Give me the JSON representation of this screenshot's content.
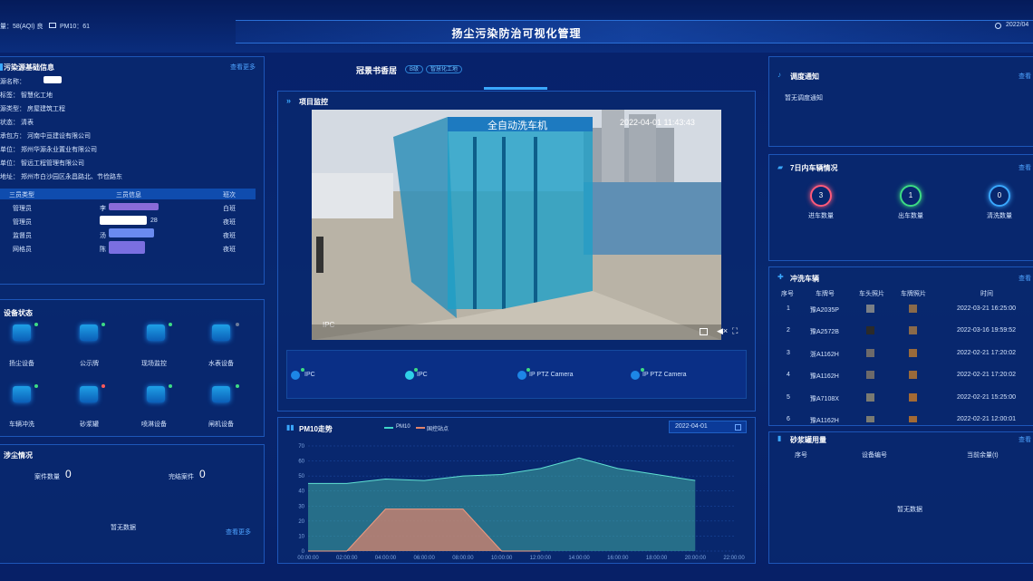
{
  "header": {
    "aqi_text": "量：58(AQI) 良",
    "pm10_text": "PM10：61",
    "title": "扬尘污染防治可视化管理",
    "date_text": "2022/04"
  },
  "left": {
    "info": {
      "title": "污染源基础信息",
      "more": "查看更多",
      "rows": [
        "源名称：",
        "标签： 智慧化工地",
        "源类型： 房屋建筑工程",
        "状态： 清表",
        "承包方： 河南中亘建设有限公司",
        "单位： 郑州华源永业置业有限公司",
        "单位： 智远工程管理有限公司",
        "地址： 郑州市白沙园区永昌路北、节俭路东"
      ],
      "staff_headers": [
        "三员类型",
        "三员信息",
        "班次"
      ],
      "staff": [
        {
          "type": "管理员",
          "info": "李",
          "shift": "白班"
        },
        {
          "type": "管理员",
          "info": "28",
          "shift": "夜班"
        },
        {
          "type": "监督员",
          "info": "汤",
          "shift": "夜班"
        },
        {
          "type": "网格员",
          "info": "陈",
          "shift": "夜班"
        }
      ]
    },
    "devices": {
      "title": "设备状态",
      "items": [
        {
          "label": "扬尘设备",
          "status": "#3ddc84"
        },
        {
          "label": "公示牌",
          "status": "#3ddc84"
        },
        {
          "label": "现场监控",
          "status": "#3ddc84"
        },
        {
          "label": "水表设备",
          "status": "#6b7a99"
        },
        {
          "label": "车辆冲洗",
          "status": "#3ddc84"
        },
        {
          "label": "砂浆罐",
          "status": "#ff5a5a"
        },
        {
          "label": "喷淋设备",
          "status": "#3ddc84"
        },
        {
          "label": "闸机设备",
          "status": "#3ddc84"
        }
      ]
    },
    "cases": {
      "title": "涉尘情况",
      "case_label": "案件数量",
      "case_value": "0",
      "done_label": "完结案件",
      "done_value": "0",
      "empty": "暂无数据",
      "more": "查看更多"
    }
  },
  "center": {
    "site_name": "冠景书香居",
    "chip1": "B级",
    "chip2": "智慧化工地",
    "monitor": {
      "title": "项目监控",
      "timestamp": "2022-04-01 11:43:43",
      "banner": "全自动洗车机",
      "osd": "IPC",
      "cameras": [
        "IPC",
        "IPC",
        "IP PTZ Camera",
        "IP PTZ Camera"
      ]
    },
    "pm10": {
      "title": "PM10走势",
      "legend_pm10": "PM10",
      "legend_limit": "国控站点",
      "date": "2022-04-01"
    }
  },
  "right": {
    "dispatch": {
      "title": "调度通知",
      "more": "查看",
      "empty": "暂无调度通知"
    },
    "vehicles": {
      "title": "7日内车辆情况",
      "more": "查看",
      "stats": [
        {
          "value": "3",
          "label": "进车数量",
          "color": "#ff5a7a"
        },
        {
          "value": "1",
          "label": "出车数量",
          "color": "#3ddc84"
        },
        {
          "value": "0",
          "label": "清洗数量",
          "color": "#3aa8ff"
        }
      ]
    },
    "wash": {
      "title": "冲洗车辆",
      "more": "查看",
      "headers": [
        "序号",
        "车牌号",
        "车头照片",
        "车牌照片",
        "时间"
      ],
      "rows": [
        {
          "no": "1",
          "plate": "豫A2035P",
          "time": "2022-03-21 16:25:00"
        },
        {
          "no": "2",
          "plate": "豫A2572B",
          "time": "2022-03-16 19:59:52"
        },
        {
          "no": "3",
          "plate": "浙A1162H",
          "time": "2022-02-21 17:20:02"
        },
        {
          "no": "4",
          "plate": "豫A1162H",
          "time": "2022-02-21 17:20:02"
        },
        {
          "no": "5",
          "plate": "豫A7108X",
          "time": "2022-02-21 15:25:00"
        },
        {
          "no": "6",
          "plate": "豫A1162H",
          "time": "2022-02-21 12:00:01"
        }
      ]
    },
    "mortar": {
      "title": "砂浆罐用量",
      "more": "查看",
      "headers": [
        "序号",
        "设备编号",
        "当前余量(t)"
      ],
      "empty": "暂无数据"
    }
  },
  "chart_data": {
    "type": "area",
    "title": "PM10走势",
    "x": [
      "00:00:00",
      "02:00:00",
      "04:00:00",
      "06:00:00",
      "08:00:00",
      "10:00:00",
      "12:00:00",
      "14:00:00",
      "16:00:00",
      "18:00:00",
      "20:00:00",
      "22:00:00"
    ],
    "ylim": [
      0,
      70
    ],
    "yticks": [
      0,
      10,
      20,
      30,
      40,
      50,
      60,
      70
    ],
    "series": [
      {
        "name": "PM10",
        "color": "#3fa9a0",
        "points": [
          [
            0,
            45
          ],
          [
            1,
            45
          ],
          [
            2,
            48
          ],
          [
            3,
            47
          ],
          [
            4,
            50
          ],
          [
            5,
            51
          ],
          [
            6,
            55
          ],
          [
            7,
            62
          ],
          [
            8,
            55
          ],
          [
            9,
            51
          ],
          [
            10,
            47
          ]
        ]
      },
      {
        "name": "国控站点",
        "color": "#e2836b",
        "points": [
          [
            0,
            0
          ],
          [
            1,
            0
          ],
          [
            2,
            28
          ],
          [
            3,
            28
          ],
          [
            4,
            28
          ],
          [
            5,
            0
          ],
          [
            6,
            0
          ]
        ]
      }
    ]
  }
}
